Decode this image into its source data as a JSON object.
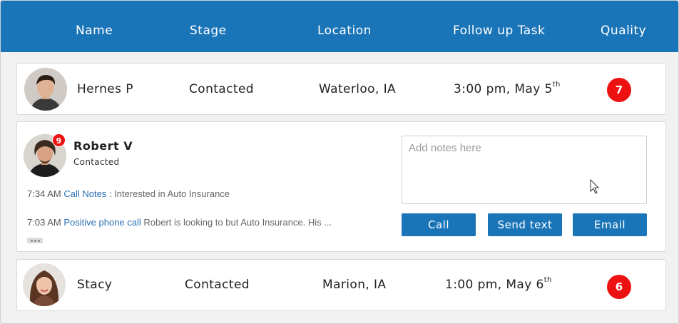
{
  "header": {
    "columns": [
      "Name",
      "Stage",
      "Location",
      "Follow up Task",
      "Quality"
    ]
  },
  "leads": [
    {
      "name": "Hernes P",
      "stage": "Contacted",
      "location": "Waterloo, IA",
      "task_time": "3:00 pm, May 5",
      "task_suffix": "th",
      "quality": "7"
    },
    {
      "name": "Stacy",
      "stage": "Contacted",
      "location": "Marion, IA",
      "task_time": "1:00 pm, May 6",
      "task_suffix": "th",
      "quality": "6"
    }
  ],
  "expanded": {
    "name": "Robert V",
    "stage": "Contacted",
    "badge_count": "9",
    "activity": [
      {
        "time": "7:34 AM",
        "type": "Call Notes",
        "separator": " : ",
        "text": "Interested in Auto Insurance"
      },
      {
        "time": "7:03 AM",
        "type": "Positive phone call",
        "separator": " ",
        "text": "Robert is looking to but Auto Insurance. His ..."
      }
    ],
    "notes_placeholder": "Add notes here",
    "actions": {
      "call": "Call",
      "send_text": "Send text",
      "email": "Email"
    }
  },
  "colors": {
    "header_bg": "#1a74b8",
    "button_bg": "#1a74b8",
    "quality_badge": "#ee1111",
    "link": "#2a6fb3"
  },
  "icons": [
    "avatar-hernes",
    "avatar-robert",
    "avatar-stacy",
    "more-dots-icon",
    "mouse-pointer-icon"
  ]
}
